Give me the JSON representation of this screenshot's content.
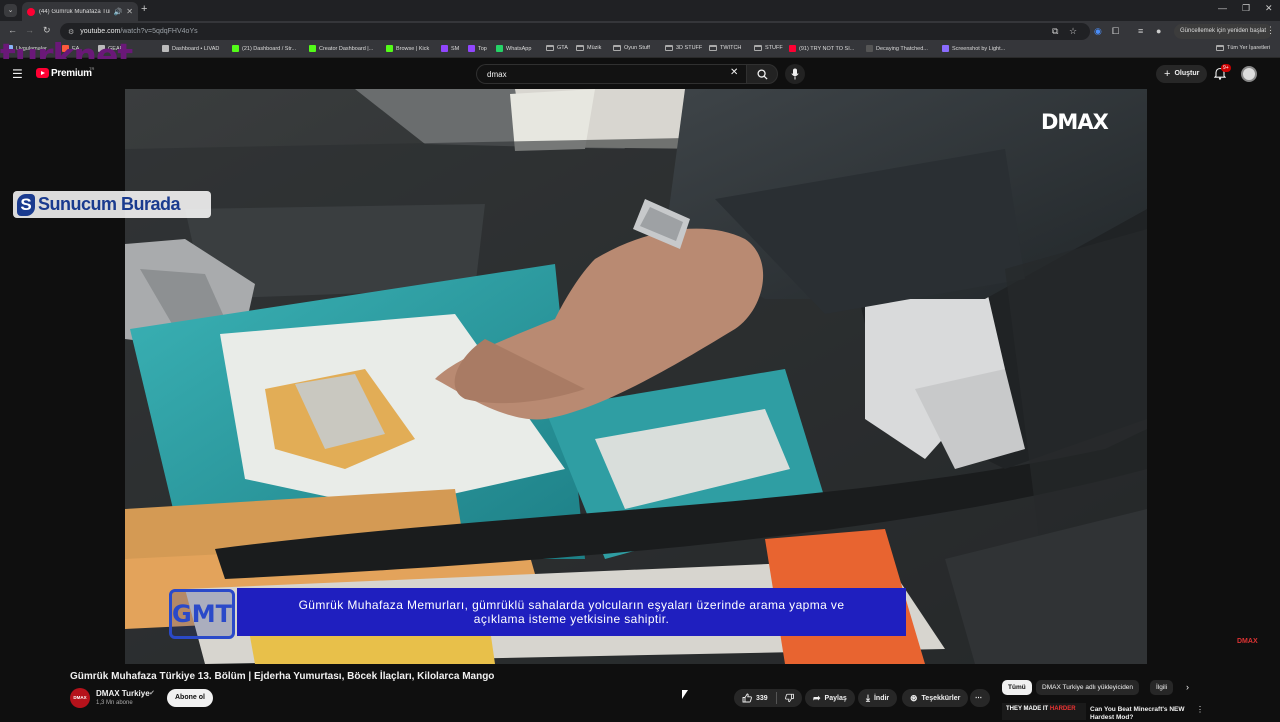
{
  "browser": {
    "tab_title": "(44) Gümrük Muhafaza Türki",
    "url_host": "youtube.com",
    "url_path": "/watch?v=5qdqFHV4oYs",
    "update_label": "Güncellemek için yeniden başlat",
    "bookmarks": [
      {
        "label": "Uygulamalar",
        "icon": "grid-icon",
        "color": "#8ab4f8"
      },
      {
        "label": "EA",
        "icon": "ea-icon",
        "color": "#ff5a3c"
      },
      {
        "label": "GEAR",
        "icon": "gear-icon",
        "color": "#bbbbbb"
      },
      {
        "label": "Dashboard • LIVAD",
        "icon": "site-icon",
        "color": "#bbbbbb"
      },
      {
        "label": "(21) Dashboard / Str...",
        "icon": "site-icon",
        "color": "#53fc18"
      },
      {
        "label": "Creator Dashboard |...",
        "icon": "kick-icon",
        "color": "#53fc18"
      },
      {
        "label": "Browse | Kick",
        "icon": "kick-icon",
        "color": "#53fc18"
      },
      {
        "label": "SM",
        "icon": "twitch-icon",
        "color": "#9146ff"
      },
      {
        "label": "Top",
        "icon": "twitch-icon",
        "color": "#9146ff"
      },
      {
        "label": "WhatsApp",
        "icon": "whatsapp-icon",
        "color": "#25d366"
      },
      {
        "label": "GTA",
        "icon": "folder-icon",
        "color": ""
      },
      {
        "label": "Müzik",
        "icon": "folder-icon",
        "color": ""
      },
      {
        "label": "Oyun Stuff",
        "icon": "folder-icon",
        "color": ""
      },
      {
        "label": "3D STUFF",
        "icon": "folder-icon",
        "color": ""
      },
      {
        "label": "TWITCH",
        "icon": "folder-icon",
        "color": ""
      },
      {
        "label": "STUFF",
        "icon": "folder-icon",
        "color": ""
      },
      {
        "label": "(91) TRY NOT TO SI...",
        "icon": "youtube-icon",
        "color": "#ff0033"
      },
      {
        "label": "Decaying Thatched...",
        "icon": "site-icon",
        "color": "#555555"
      },
      {
        "label": "Screenshot by Light...",
        "icon": "lightshot-icon",
        "color": "#8a6cff"
      }
    ],
    "all_bookmarks": "Tüm Yer İşaretleri"
  },
  "watermark": {
    "text": "turknet"
  },
  "youtube": {
    "logo_text": "Premium",
    "logo_region": "TR",
    "search_value": "dmax",
    "create_label": "Oluştur",
    "notif_count": "9+"
  },
  "video": {
    "brand": "DMAX",
    "sponsor_text": "Sunucum Burada",
    "sponsor_mark": "S",
    "gmt_logo": "GMT",
    "subtitle": "Gümrük Muhafaza Memurları, gümrüklü sahalarda yolcuların eşyaları üzerinde arama yapma ve açıklama isteme yetkisine sahiptir.",
    "corner_logo": "DMAX",
    "title": "Gümrük Muhafaza Türkiye 13. Bölüm | Ejderha Yumurtası, Böcek İlaçları, Kilolarca Mango"
  },
  "channel": {
    "avatar_text": "DMAX",
    "name": "DMAX Turkiye",
    "subs": "1,3 Mn abone",
    "subscribe_label": "Abone ol"
  },
  "actions": {
    "likes": "339",
    "share": "Paylaş",
    "download": "İndir",
    "thanks": "Teşekkürler"
  },
  "sidebar": {
    "chips": [
      "Tümü",
      "DMAX Turkiye adlı yükleyiciden",
      "İlgili"
    ],
    "rec_thumb_text_a": "THEY MADE IT",
    "rec_thumb_text_b": "HARDER",
    "rec_title": "Can You Beat Minecraft's NEW Hardest Mod?"
  },
  "colors": {
    "accent": "#ff0033",
    "subtitle_bg": "#1f1fbf",
    "watermark": "#6a1878"
  }
}
